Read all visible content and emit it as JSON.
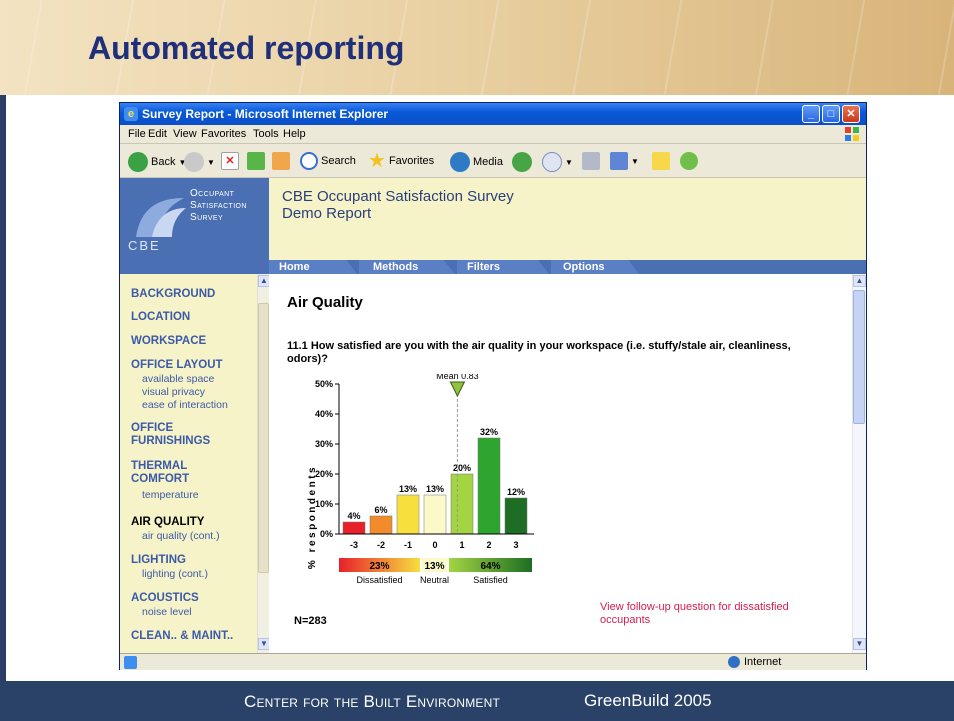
{
  "slide": {
    "title": "Automated reporting",
    "footer_left": "Center for the Built Environment",
    "footer_right": "GreenBuild 2005"
  },
  "browser": {
    "window_title": "Survey Report - Microsoft Internet Explorer",
    "menu": [
      "File",
      "Edit",
      "View",
      "Favorites",
      "Tools",
      "Help"
    ],
    "toolbar": {
      "back": "Back",
      "search": "Search",
      "favorites": "Favorites",
      "media": "Media"
    },
    "status_zone": "Internet"
  },
  "site": {
    "logo_lines": [
      "Occupant",
      "Satisfaction",
      "Survey"
    ],
    "logo_short": "CBE",
    "report_title_line1": "CBE Occupant Satisfaction Survey",
    "report_title_line2": "Demo Report",
    "tabs": [
      "Home",
      "Methods",
      "Filters",
      "Options"
    ]
  },
  "sidebar": [
    {
      "label": "BACKGROUND",
      "subs": []
    },
    {
      "label": "LOCATION",
      "subs": []
    },
    {
      "label": "WORKSPACE",
      "subs": []
    },
    {
      "label": "OFFICE LAYOUT",
      "subs": [
        "available space",
        "visual privacy",
        "ease of interaction"
      ]
    },
    {
      "label": "OFFICE FURNISHINGS",
      "subs": []
    },
    {
      "label": "THERMAL COMFORT",
      "subs": [
        "temperature"
      ]
    },
    {
      "label": "AIR QUALITY",
      "subs": [
        "air quality (cont.)"
      ],
      "active": true
    },
    {
      "label": "LIGHTING",
      "subs": [
        "lighting (cont.)"
      ]
    },
    {
      "label": "ACOUSTICS",
      "subs": [
        "noise level"
      ]
    },
    {
      "label": "CLEAN.. & MAINT..",
      "subs": []
    }
  ],
  "content": {
    "heading": "Air Quality",
    "question": "11.1 How satisfied are you with the air quality in your workspace (i.e. stuffy/stale air, cleanliness, odors)?",
    "n_label": "N=283",
    "followup_link": "View follow-up question for dissatisfied occupants"
  },
  "chart_data": {
    "type": "bar",
    "categories": [
      "-3",
      "-2",
      "-1",
      "0",
      "1",
      "2",
      "3"
    ],
    "values": [
      4,
      6,
      13,
      13,
      20,
      32,
      12
    ],
    "value_labels": [
      "4%",
      "6%",
      "13%",
      "13%",
      "20%",
      "32%",
      "12%"
    ],
    "colors": [
      "#e8202a",
      "#f28b2c",
      "#f7df3e",
      "#fbf9c8",
      "#a3d442",
      "#2ea52e",
      "#1d6e24"
    ],
    "ylabel": "% respondents",
    "y_ticks": [
      "0%",
      "10%",
      "20%",
      "30%",
      "40%",
      "50%"
    ],
    "ylim": [
      0,
      50
    ],
    "mean": 0.83,
    "mean_label": "Mean 0.83",
    "summary": [
      {
        "label": "Dissatisfied",
        "value": "23%"
      },
      {
        "label": "Neutral",
        "value": "13%"
      },
      {
        "label": "Satisfied",
        "value": "64%"
      }
    ]
  }
}
